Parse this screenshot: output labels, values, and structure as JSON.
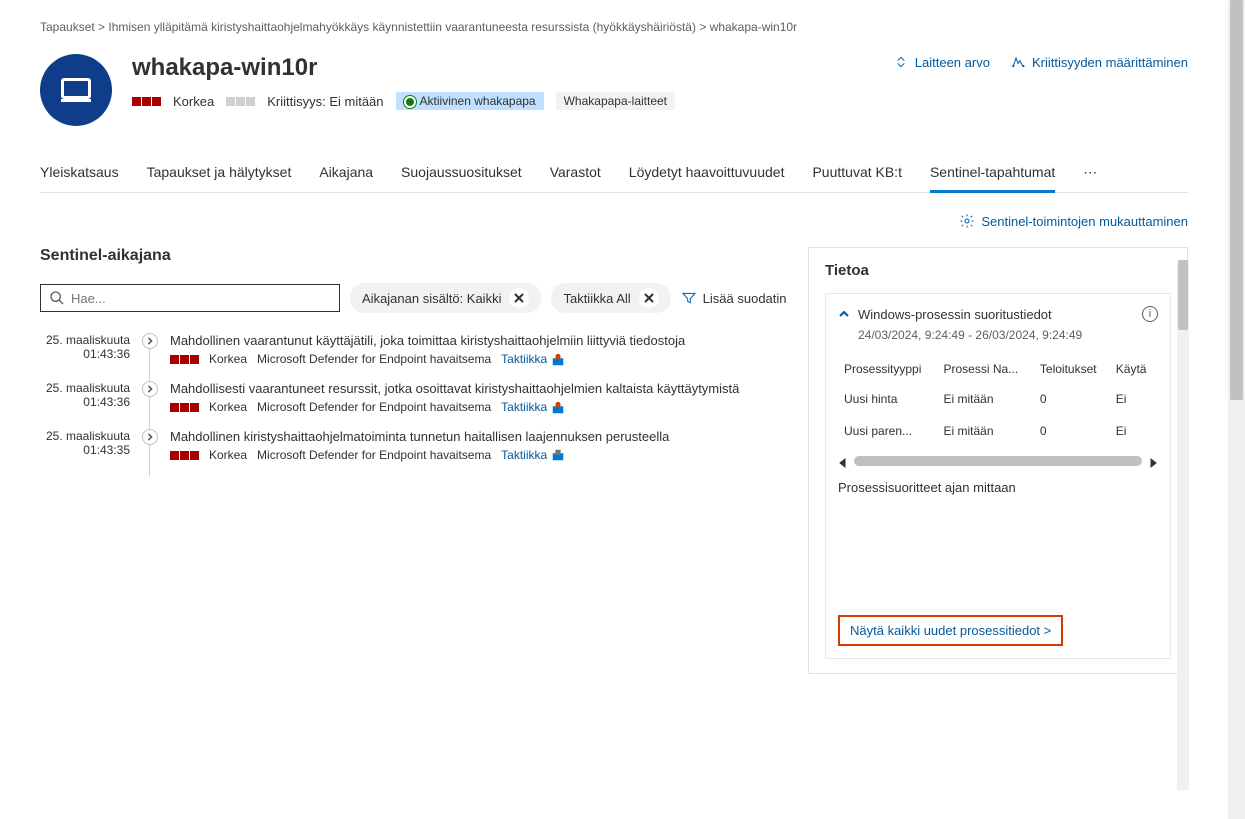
{
  "breadcrumb": {
    "prefix": "Tapaukset &gt;",
    "text": "Ihmisen ylläpitämä kiristyshaittaohjelmahyökkäys käynnistettiin vaarantuneesta resurssista (hyökkäyshäiriöstä) &gt; whakapa-win10r"
  },
  "device": {
    "title": "whakapa-win10r",
    "severity": "Korkea",
    "criticality_label": "Kriittisyys:",
    "criticality_value": "Ei mitään",
    "active_user": "Aktiivinen whakapapa",
    "devices_pill": "Whakapapa-laitteet"
  },
  "header_actions": {
    "device_value": "Laitteen arvo",
    "criticality_set": "Kriittisyyden määrittäminen"
  },
  "tabs": {
    "overview": "Yleiskatsaus",
    "incidents": "Tapaukset ja hälytykset",
    "timeline": "Aikajana",
    "security_recs": "Suojaussuositukset",
    "inventories": "Varastot",
    "vulnerabilities": "Löydetyt haavoittuvuudet",
    "missing_kbs": "Puuttuvat KB:t",
    "sentinel_events": "Sentinel-tapahtumat"
  },
  "customize": "Sentinel-toimintojen mukauttaminen",
  "timeline": {
    "title": "Sentinel-aikajana",
    "search_placeholder": "Hae...",
    "chip_content": "Aikajanan sisältö: Kaikki",
    "chip_tactic": "Taktiikka All",
    "add_filter": "Lisää suodatin"
  },
  "events": [
    {
      "date": "25. maaliskuuta",
      "time": "01:43:36",
      "title": "Mahdollinen vaarantunut käyttäjätili, joka toimittaa kiristyshaittaohjelmiin liittyviä tiedostoja",
      "severity": "Korkea",
      "detector": "Microsoft Defender for Endpoint havaitsema",
      "tactic": "Taktiikka"
    },
    {
      "date": "25. maaliskuuta",
      "time": "01:43:36",
      "title": "Mahdollisesti vaarantuneet resurssit, jotka osoittavat kiristyshaittaohjelmien kaltaista käyttäytymistä",
      "severity": "Korkea",
      "detector": "Microsoft Defender for Endpoint havaitsema",
      "tactic": "Taktiikka"
    },
    {
      "date": "25. maaliskuuta",
      "time": "01:43:35",
      "title": "Mahdollinen kiristyshaittaohjelmatoiminta tunnetun haitallisen laajennuksen perusteella",
      "severity": "Korkea",
      "detector": "Microsoft Defender for Endpoint havaitsema",
      "tactic": "Taktiikka"
    }
  ],
  "info_panel": {
    "title": "Tietoa",
    "section": "Windows-prosessin suoritustiedot",
    "date_range": "24/03/2024, 9:24:49 - 26/03/2024, 9:24:49",
    "columns": {
      "type": "Prosessityyppi",
      "name": "Prosessi Na...",
      "teloitukset": "Teloitukset",
      "kayta": "Käytä"
    },
    "rows": [
      {
        "type": "Uusi hinta",
        "name": "Ei mitään",
        "teloitukset": "0",
        "kayta": "Ei"
      },
      {
        "type": "Uusi paren...",
        "name": "Ei mitään",
        "teloitukset": "0",
        "kayta": "Ei"
      }
    ],
    "chart_label": "Prosessisuoritteet ajan mittaan",
    "show_all": "Näytä kaikki uudet prosessitiedot &gt;"
  }
}
